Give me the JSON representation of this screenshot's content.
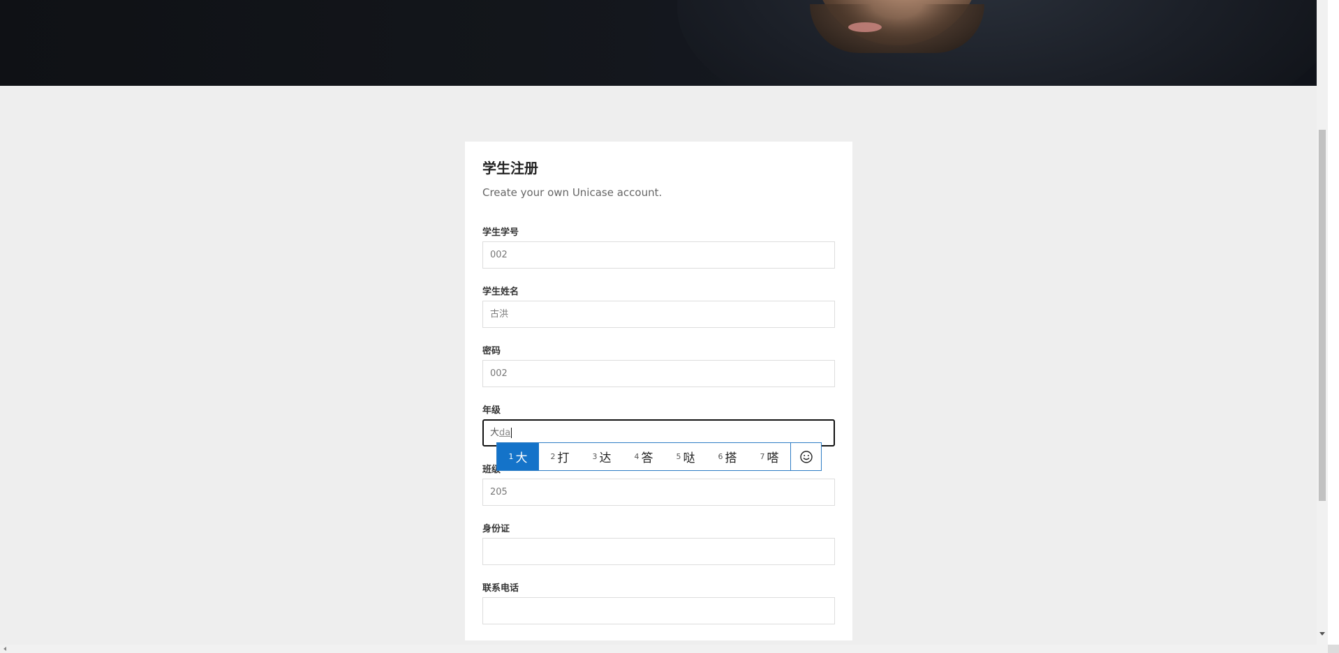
{
  "hero": {
    "image": "bearded-man-portrait"
  },
  "form": {
    "title": "学生注册",
    "subtitle": "Create your own Unicase account.",
    "fields": {
      "student_id": {
        "label": "学生学号",
        "value": "002"
      },
      "student_name": {
        "label": "学生姓名",
        "value": "古洪"
      },
      "password": {
        "label": "密码",
        "value": "002"
      },
      "grade": {
        "label": "年级",
        "committed": "大",
        "composing": "da"
      },
      "class": {
        "label": "班级",
        "value": "205"
      },
      "id_card": {
        "label": "身份证",
        "value": ""
      },
      "phone": {
        "label": "联系电话",
        "value": ""
      }
    }
  },
  "ime": {
    "candidates": [
      {
        "num": "1",
        "text": "大"
      },
      {
        "num": "2",
        "text": "打"
      },
      {
        "num": "3",
        "text": "达"
      },
      {
        "num": "4",
        "text": "答"
      },
      {
        "num": "5",
        "text": "哒"
      },
      {
        "num": "6",
        "text": "搭"
      },
      {
        "num": "7",
        "text": "嗒"
      }
    ],
    "selected_index": 0,
    "emoji_button_icon": "smiley-icon",
    "accent_color": "#1473c9"
  }
}
